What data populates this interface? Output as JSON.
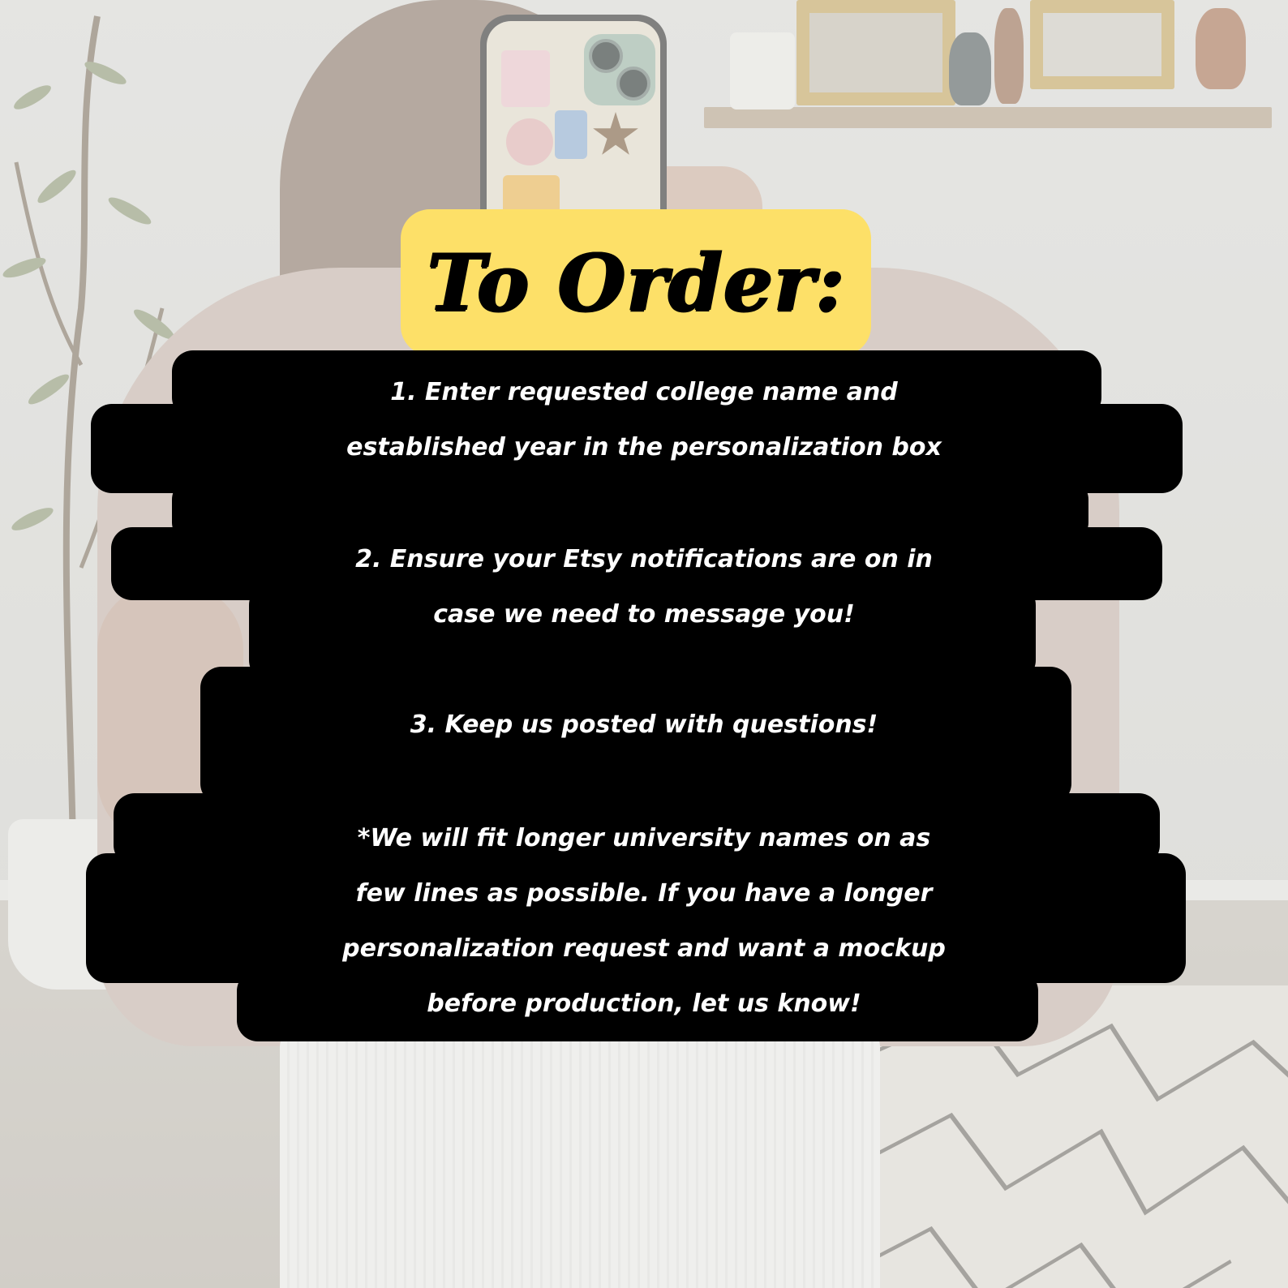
{
  "title": "To Order:",
  "steps": [
    {
      "lines": [
        "1. Enter requested college name and",
        "established year in the personalization box"
      ]
    },
    {
      "lines": [
        "2. Ensure your Etsy notifications are on in",
        "case we need to message you!"
      ]
    },
    {
      "lines": [
        "3. Keep us posted with questions!"
      ]
    }
  ],
  "note": {
    "lines": [
      "*We will fit longer university names on as",
      "few lines as possible. If you have a longer",
      "personalization request and want a mockup",
      "before production, let us know!"
    ]
  },
  "colors": {
    "title_highlight": "#fde068",
    "text_background": "#000000",
    "text": "#ffffff"
  }
}
